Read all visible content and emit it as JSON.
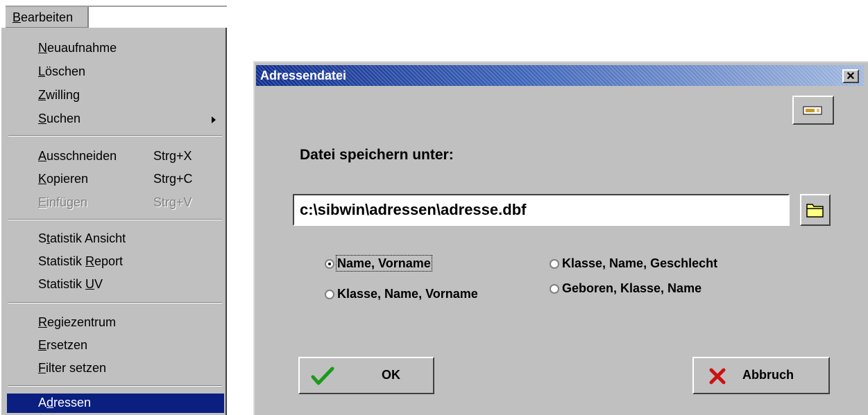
{
  "menu": {
    "title_rest": "earbeiten",
    "items": [
      {
        "ul": "N",
        "rest": "euaufnahme"
      },
      {
        "ul": "L",
        "rest": "öschen"
      },
      {
        "ul": "Z",
        "rest": "willing"
      },
      {
        "ul": "S",
        "rest": "uchen"
      },
      {
        "ul": "A",
        "rest": "usschneiden",
        "shortcut": "Strg+X"
      },
      {
        "ul": "K",
        "rest": "opieren",
        "shortcut": "Strg+C"
      },
      {
        "ul": "E",
        "rest": "infügen",
        "shortcut": "Strg+V"
      },
      {
        "pre": "S",
        "ul": "t",
        "rest": "atistik Ansicht"
      },
      {
        "pre": "Statistik ",
        "ul": "R",
        "rest": "eport"
      },
      {
        "pre": "Statistik ",
        "ul": "U",
        "rest": "V"
      },
      {
        "ul": "R",
        "rest": "egiezentrum"
      },
      {
        "ul": "E",
        "rest": "rsetzen"
      },
      {
        "ul": "F",
        "rest": "ilter setzen"
      },
      {
        "pre": "A",
        "ul": "d",
        "rest": "ressen"
      }
    ]
  },
  "dialog": {
    "title": "Adressendatei",
    "close_glyph": "✕",
    "save_label": "Datei speichern unter:",
    "path_value": "c:\\sibwin\\adressen\\adresse.dbf",
    "options": [
      {
        "label": "Name, Vorname",
        "selected": true
      },
      {
        "label": "Klasse, Name, Vorname",
        "selected": false
      },
      {
        "label": "Klasse, Name, Geschlecht",
        "selected": false
      },
      {
        "label": "Geboren, Klasse, Name",
        "selected": false
      }
    ],
    "ok_label": "OK",
    "cancel_label": "Abbruch"
  }
}
